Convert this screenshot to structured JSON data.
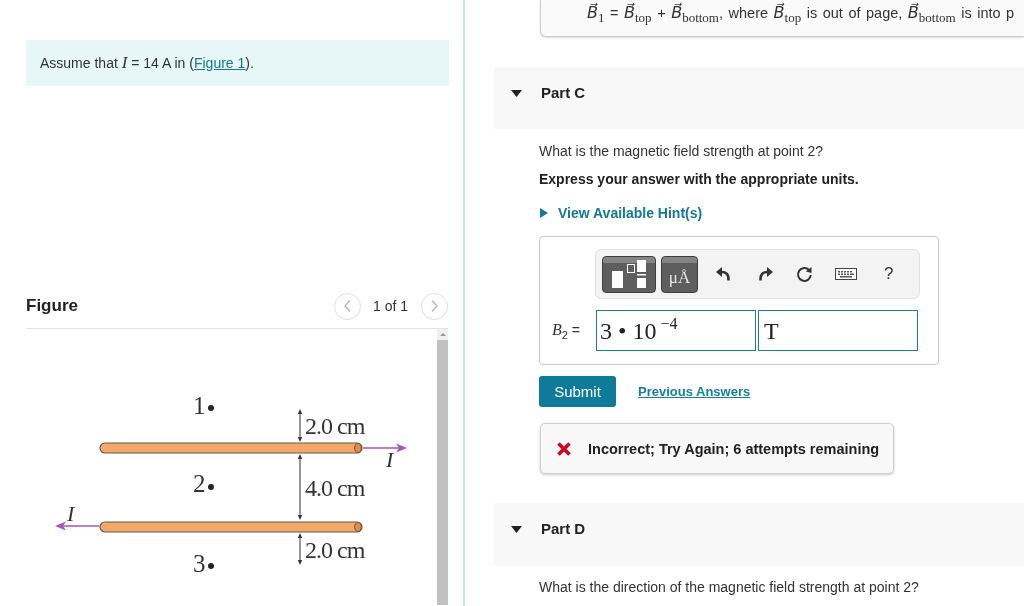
{
  "context_card": {
    "formula": "*B⃗*$_{1}$ = *B⃗*$_{top}$ + *B⃗*$_{bottom}$, where *B⃗*$_{top}$ is out of page, *B⃗*$_{bottom}$ is into p"
  },
  "intro": {
    "text": "Assume that *I* = 14 A in (",
    "link": "Figure 1",
    "text_end": ")."
  },
  "figure": {
    "title": "Figure",
    "pager": "1 of 1",
    "points": [
      "1",
      "2",
      "3"
    ],
    "distances": [
      "2.0 cm",
      "4.0 cm",
      "2.0 cm"
    ],
    "currents": [
      "I",
      "I"
    ]
  },
  "parts": [
    {
      "title": "Part C",
      "expanded": true,
      "question": "What is the magnetic field strength at point 2?",
      "instruction": "Express your answer with the appropriate units.",
      "hint": {
        "label": "View Available Hint(s)",
        "expanded": false
      },
      "answer": {
        "toolbar": {
          "units_button": "μÅ",
          "help": "?"
        },
        "label": "*B*$_{2}$ =",
        "value": "3 • 10$^{−4}$",
        "unit": "T"
      },
      "submit": "Submit",
      "previous_answers": "Previous Answers",
      "feedback": {
        "kind": "incorrect",
        "text": "Incorrect; Try Again; 6 attempts remaining"
      }
    },
    {
      "title": "Part D",
      "expanded": true,
      "question": "What is the direction of the magnetic field strength at point 2?"
    }
  ]
}
